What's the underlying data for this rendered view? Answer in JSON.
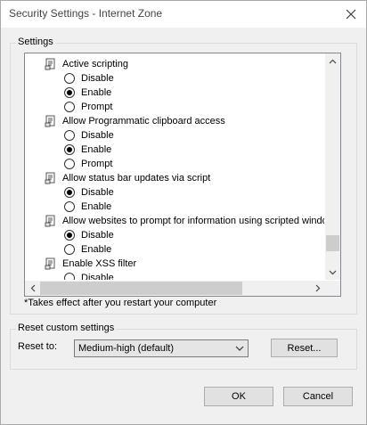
{
  "window": {
    "title": "Security Settings - Internet Zone",
    "close_icon": "close-icon"
  },
  "settings_group": {
    "legend": "Settings"
  },
  "settings_list": {
    "items": [
      {
        "type": "setting",
        "label": "Active scripting",
        "icon": "script-setting-icon"
      },
      {
        "type": "option",
        "label": "Disable",
        "checked": false
      },
      {
        "type": "option",
        "label": "Enable",
        "checked": true
      },
      {
        "type": "option",
        "label": "Prompt",
        "checked": false
      },
      {
        "type": "setting",
        "label": "Allow Programmatic clipboard access",
        "icon": "script-setting-icon"
      },
      {
        "type": "option",
        "label": "Disable",
        "checked": false
      },
      {
        "type": "option",
        "label": "Enable",
        "checked": true
      },
      {
        "type": "option",
        "label": "Prompt",
        "checked": false
      },
      {
        "type": "setting",
        "label": "Allow status bar updates via script",
        "icon": "script-setting-icon"
      },
      {
        "type": "option",
        "label": "Disable",
        "checked": true
      },
      {
        "type": "option",
        "label": "Enable",
        "checked": false
      },
      {
        "type": "setting",
        "label": "Allow websites to prompt for information using scripted windo",
        "icon": "script-setting-icon"
      },
      {
        "type": "option",
        "label": "Disable",
        "checked": true
      },
      {
        "type": "option",
        "label": "Enable",
        "checked": false
      },
      {
        "type": "setting",
        "label": "Enable XSS filter",
        "icon": "script-setting-icon"
      },
      {
        "type": "option",
        "label": "Disable",
        "checked": false
      }
    ],
    "vertical_scroll_position": 0.85,
    "horizontal_scroll_position": 0.0
  },
  "note": "*Takes effect after you restart your computer",
  "reset_group": {
    "legend": "Reset custom settings",
    "reset_to_label": "Reset to:",
    "selected_value": "Medium-high (default)",
    "reset_button": "Reset..."
  },
  "footer": {
    "ok": "OK",
    "cancel": "Cancel"
  }
}
